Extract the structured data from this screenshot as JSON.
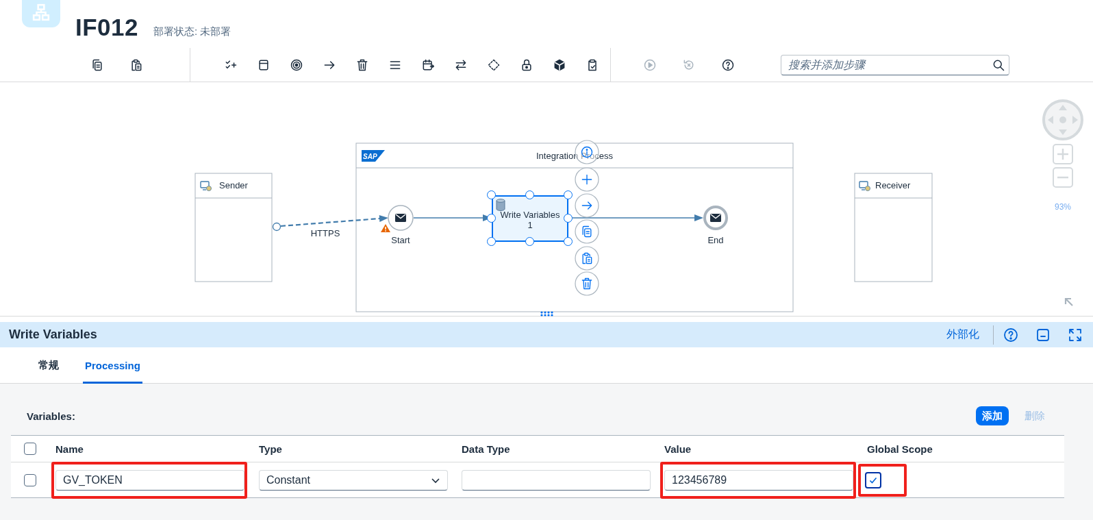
{
  "header": {
    "title": "IF012",
    "status": "部署状态: 未部署"
  },
  "toolbar": {
    "groups": [
      {
        "tools": [
          {
            "kind": "copy",
            "disabled": false
          },
          {
            "kind": "paste",
            "disabled": false
          }
        ]
      },
      {
        "tools": [
          {
            "kind": "checklist",
            "disabled": false
          },
          {
            "kind": "window",
            "disabled": false
          },
          {
            "kind": "target",
            "disabled": false
          },
          {
            "kind": "arrow",
            "disabled": false
          },
          {
            "kind": "trash",
            "disabled": false
          },
          {
            "kind": "menu",
            "disabled": false
          },
          {
            "kind": "calendar",
            "disabled": false
          },
          {
            "kind": "swap",
            "disabled": false
          },
          {
            "kind": "diamond",
            "disabled": false
          },
          {
            "kind": "lock",
            "disabled": false
          },
          {
            "kind": "cube",
            "disabled": false
          },
          {
            "kind": "clipboard",
            "disabled": false
          }
        ]
      },
      {
        "tools": [
          {
            "kind": "play",
            "disabled": true
          },
          {
            "kind": "reset",
            "disabled": true
          },
          {
            "kind": "help",
            "disabled": false
          }
        ]
      }
    ],
    "search": {
      "placeholder": "搜索并添加步骤"
    }
  },
  "diagram": {
    "sender": {
      "label": "Sender"
    },
    "receiver": {
      "label": "Receiver"
    },
    "process": {
      "title": "Integration Process",
      "logo_text": "SAP"
    },
    "connection": {
      "label": "HTTPS"
    },
    "start": {
      "label": "Start",
      "warning": true
    },
    "step": {
      "label": "Write Variables 1",
      "selected": true
    },
    "end": {
      "label": "End"
    },
    "step_actions": [
      {
        "kind": "info"
      },
      {
        "kind": "add"
      },
      {
        "kind": "connect"
      },
      {
        "kind": "copy"
      },
      {
        "kind": "paste"
      },
      {
        "kind": "delete"
      }
    ],
    "zoom": {
      "reading": "93%"
    }
  },
  "panel": {
    "title": "Write Variables",
    "externalize": "外部化",
    "tabs": [
      {
        "label": "常规",
        "selected": false
      },
      {
        "label": "Processing",
        "selected": true
      }
    ],
    "section_label": "Variables:",
    "buttons": [
      {
        "label": "添加",
        "disabled": false
      },
      {
        "label": "删除",
        "disabled": true
      }
    ],
    "table": {
      "all_selected": false,
      "columns": [
        "Name",
        "Type",
        "Data Type",
        "Value",
        "Global Scope"
      ],
      "rows": [
        {
          "selected": false,
          "cells": [
            {
              "kind": "text",
              "value": "GV_TOKEN",
              "highlighted": true
            },
            {
              "kind": "select",
              "value": "Constant",
              "highlighted": false
            },
            {
              "kind": "text",
              "highlighted": false
            },
            {
              "kind": "text",
              "value": "123456789",
              "highlighted": true
            },
            {
              "kind": "checkbox",
              "checked": true,
              "highlighted": true
            }
          ]
        }
      ]
    }
  }
}
